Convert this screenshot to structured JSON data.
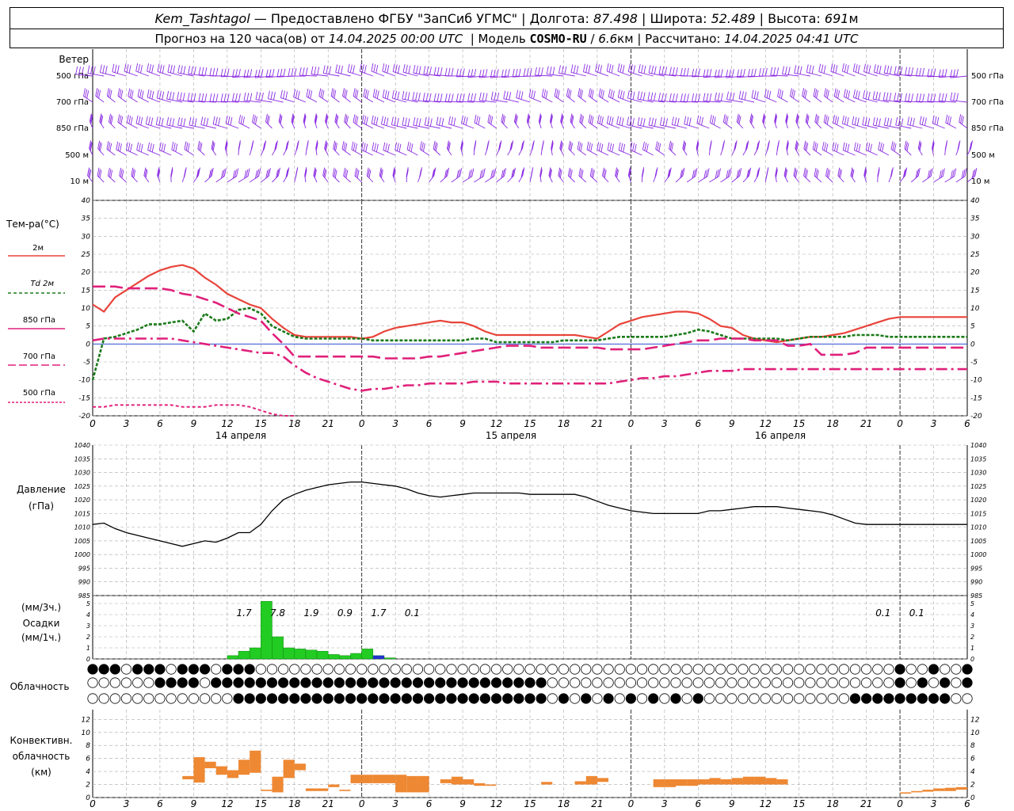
{
  "header": {
    "station": "Kem_Tashtagol",
    "provider": " — Предоставлено ФГБУ \"ЗапСиб УГМС\" | Долгота: ",
    "lon": "87.498",
    "lat_label": " | Широта: ",
    "lat": "52.489",
    "alt_label": " | Высота: ",
    "alt": "691",
    "alt_unit": "м",
    "forecast_prefix": "Прогноз на 120 часа(ов) от ",
    "forecast_start": "14.04.2025 00:00 UTC",
    "model_label": "  | Модель ",
    "model": "COSMO-RU",
    "res_sep": " / ",
    "resolution": "6.6",
    "res_unit": "км",
    "computed_label": " | Рассчитано: ",
    "computed": "14.04.2025 04:41 UTC"
  },
  "wind": {
    "title": "Ветер",
    "levels": [
      "500 гПа",
      "700 гПа",
      "850 гПа",
      "500 м",
      "10  м"
    ],
    "barb_color": "#8a2be2"
  },
  "temperature": {
    "title": "Тем-ра(°С)",
    "yticks": [
      40,
      35,
      30,
      25,
      20,
      15,
      10,
      5,
      0,
      -5,
      -10,
      -15,
      -20
    ],
    "legend": [
      "2м",
      "Td  2м",
      "850 гПа",
      "700 гПа",
      "500 гПа"
    ],
    "colors": {
      "t2m": "#e8443a",
      "td2m": "#1a7a1a",
      "t850": "#e0207a",
      "t700": "#e0207a",
      "t500": "#e0207a",
      "zero": "#3050d0"
    }
  },
  "time_axis": {
    "xticks": [
      "0",
      "3",
      "6",
      "9",
      "12",
      "15",
      "18",
      "21",
      "0",
      "3",
      "6",
      "9",
      "12",
      "15",
      "18",
      "21",
      "0",
      "3",
      "6",
      "9",
      "12",
      "15",
      "18",
      "21",
      "0",
      "3",
      "6"
    ],
    "days": [
      "14 апреля",
      "15 апреля",
      "16 апреля"
    ]
  },
  "pressure": {
    "title": "Давление",
    "unit": "(гПа)",
    "yticks": [
      1040,
      1035,
      1030,
      1025,
      1020,
      1015,
      1010,
      1005,
      1000,
      995,
      990,
      985
    ]
  },
  "precip": {
    "unit3": "(мм/3ч.)",
    "title": "Осадки",
    "unit1": "(мм/1ч.)",
    "yticks": [
      5,
      4,
      3,
      2,
      1,
      0
    ],
    "labels": [
      "1.7",
      "7.8",
      "1.9",
      "0.9",
      "1.7",
      "0.1",
      "0.1",
      "0.1"
    ],
    "colors": {
      "rain": "#22cc22",
      "snow": "#2233cc"
    }
  },
  "cloudiness": {
    "title": "Облачность"
  },
  "convective": {
    "title_lines": [
      "Конвективн.",
      "облачность",
      "(км)"
    ],
    "yticks": [
      12,
      10,
      8,
      6,
      4,
      2,
      0
    ],
    "color": "#ee8833"
  },
  "chart_data": [
    {
      "type": "line",
      "title": "Тем-ра(°С)",
      "x_hours": [
        0,
        1,
        2,
        3,
        4,
        5,
        6,
        7,
        8,
        9,
        10,
        11,
        12,
        13,
        14,
        15,
        16,
        17,
        18,
        19,
        20,
        21,
        22,
        23,
        24,
        25,
        26,
        27,
        28,
        29,
        30,
        31,
        32,
        33,
        34,
        35,
        36,
        37,
        38,
        39,
        40,
        41,
        42,
        43,
        44,
        45,
        46,
        47,
        48,
        49,
        50,
        51,
        52,
        53,
        54,
        55,
        56,
        57,
        58,
        59,
        60,
        61,
        62,
        63,
        64,
        65,
        66,
        67,
        68,
        69,
        70,
        71,
        72,
        73,
        74,
        75,
        76,
        77,
        78
      ],
      "ylim": [
        -20,
        40
      ],
      "series": [
        {
          "name": "2м",
          "values": [
            11,
            9,
            13,
            15,
            17,
            19,
            20.5,
            21.5,
            22,
            21,
            18.5,
            16.5,
            14,
            12.5,
            11,
            10,
            7,
            4.5,
            2.5,
            2,
            2,
            2,
            2,
            2,
            1.5,
            2,
            3.5,
            4.5,
            5,
            5.5,
            6,
            6.5,
            6,
            6,
            5,
            3.5,
            2.5,
            2.5,
            2.5,
            2.5,
            2.5,
            2.5,
            2.5,
            2.5,
            2,
            1.5,
            3.5,
            5.5,
            6.5,
            7.5,
            8,
            8.5,
            9,
            9,
            8.5,
            7,
            5,
            4.5,
            2.5,
            1.5,
            1,
            0.5,
            1,
            1.5,
            2,
            2,
            2.5,
            3,
            4,
            5,
            6,
            7,
            7.5,
            7.5,
            7.5,
            7.5,
            7.5,
            7.5,
            7.5
          ]
        },
        {
          "name": "Td 2м",
          "values": [
            -10,
            1.5,
            2,
            3,
            4,
            5.5,
            5.5,
            6,
            6.5,
            3.5,
            8.5,
            6.5,
            7,
            9.5,
            10,
            8.5,
            5,
            3.5,
            2,
            1.5,
            1.5,
            1.5,
            1.5,
            1.5,
            1.5,
            1,
            1,
            1,
            1,
            1,
            1,
            1,
            1,
            1,
            1.5,
            1.5,
            0.5,
            0.5,
            0.5,
            0.5,
            0.5,
            0.5,
            1,
            1,
            1,
            1,
            1.5,
            2,
            2,
            2,
            2,
            2,
            2.5,
            3,
            4,
            3.5,
            2.5,
            1.5,
            1.5,
            1.5,
            1.5,
            1.5,
            1,
            1.5,
            2,
            2,
            2,
            2,
            2.5,
            2.5,
            2.5,
            2,
            2,
            2,
            2,
            2,
            2,
            2,
            2
          ]
        },
        {
          "name": "850 гПа",
          "values": [
            16,
            16,
            16,
            15.5,
            15.5,
            15.5,
            15.5,
            15,
            14,
            13.5,
            12.5,
            11.5,
            10,
            8.5,
            7.5,
            6.5,
            3,
            0,
            -3.5,
            -3.5,
            -3.5,
            -3.5,
            -3.5,
            -3.5,
            -3.5,
            -3.5,
            -4,
            -4,
            -4,
            -4,
            -3.5,
            -3.5,
            -3,
            -2.5,
            -2,
            -1.5,
            -1,
            -0.5,
            -0.5,
            -0.5,
            -1,
            -1,
            -1,
            -1,
            -1,
            -1,
            -1.5,
            -1.5,
            -1.5,
            -1.5,
            -1,
            -0.5,
            0,
            0.5,
            1,
            1,
            1.5,
            1.5,
            1.5,
            1,
            1,
            1,
            -0.5,
            -0.5,
            0,
            -3,
            -3,
            -3,
            -2.5,
            -1,
            -1,
            -1,
            -1,
            -1,
            -1,
            -1,
            -1,
            -1,
            -1
          ]
        },
        {
          "name": "700 гПа",
          "values": [
            1,
            1.5,
            1.5,
            1.5,
            1.5,
            1.5,
            1.5,
            1.5,
            1,
            0.5,
            0,
            -0.5,
            -1,
            -1.5,
            -2,
            -2.5,
            -2.5,
            -3.5,
            -6,
            -8,
            -9.5,
            -10.5,
            -11.5,
            -12.5,
            -13,
            -12.5,
            -12.5,
            -12,
            -11.5,
            -11.5,
            -11,
            -11,
            -11,
            -11,
            -10.5,
            -10.5,
            -10.5,
            -11,
            -11,
            -11,
            -11,
            -11,
            -11,
            -11,
            -11,
            -11,
            -11,
            -10.5,
            -10,
            -9.5,
            -9.5,
            -9,
            -9,
            -8.5,
            -8,
            -7.5,
            -7.5,
            -7.5,
            -7,
            -7,
            -7,
            -7,
            -7,
            -7,
            -7,
            -7,
            -7,
            -7,
            -7,
            -7,
            -7,
            -7,
            -7,
            -7,
            -7,
            -7,
            -7,
            -7,
            -7
          ]
        },
        {
          "name": "500 гПа",
          "values": [
            -17.5,
            -17.5,
            -17,
            -17,
            -17,
            -17,
            -17,
            -17,
            -17.5,
            -17.5,
            -17.5,
            -17,
            -17,
            -17,
            -17.5,
            -18.5,
            -19.5,
            -20,
            -20
          ]
        }
      ]
    },
    {
      "type": "line",
      "title": "Давление",
      "x_hours": [
        0,
        1,
        2,
        3,
        4,
        5,
        6,
        7,
        8,
        9,
        10,
        11,
        12,
        13,
        14,
        15,
        16,
        17,
        18,
        19,
        20,
        21,
        22,
        23,
        24,
        25,
        26,
        27,
        28,
        29,
        30,
        31,
        32,
        33,
        34,
        35,
        36,
        37,
        38,
        39,
        40,
        41,
        42,
        43,
        44,
        45,
        46,
        47,
        48,
        49,
        50,
        51,
        52,
        53,
        54,
        55,
        56,
        57,
        58,
        59,
        60,
        61,
        62,
        63,
        64,
        65,
        66,
        67,
        68,
        69,
        70,
        71,
        72,
        73,
        74,
        75,
        76,
        77,
        78
      ],
      "ylim": [
        985,
        1040
      ],
      "series": [
        {
          "name": "Давление",
          "values": [
            1011,
            1011.5,
            1009.5,
            1008,
            1007,
            1006,
            1005,
            1004,
            1003,
            1004,
            1005,
            1004.5,
            1006,
            1008,
            1008,
            1011,
            1016,
            1020,
            1022,
            1023.5,
            1024.5,
            1025.5,
            1026,
            1026.5,
            1026.5,
            1026,
            1025.5,
            1025,
            1024,
            1022.5,
            1021.5,
            1021,
            1021.5,
            1022,
            1022.5,
            1022.5,
            1022.5,
            1022.5,
            1022.5,
            1022,
            1022,
            1022,
            1022,
            1022,
            1021,
            1019.5,
            1018,
            1017,
            1016,
            1015.5,
            1015,
            1015,
            1015,
            1015,
            1015,
            1016,
            1016,
            1016.5,
            1017,
            1017.5,
            1017.5,
            1017.5,
            1017,
            1016.5,
            1016,
            1015.5,
            1014.5,
            1013,
            1011.5,
            1011,
            1011,
            1011,
            1011,
            1011,
            1011,
            1011,
            1011,
            1011,
            1011
          ]
        }
      ]
    },
    {
      "type": "bar",
      "title": "Осадки",
      "x_hours": [
        12,
        13,
        14,
        15,
        16,
        17,
        18,
        19,
        20,
        21,
        22,
        23,
        24,
        25,
        26,
        27,
        28,
        29,
        30,
        31,
        32,
        33,
        34,
        35,
        36,
        37,
        38,
        39,
        40,
        41,
        42,
        43,
        44,
        45,
        46,
        47,
        48,
        49,
        50,
        51,
        52,
        53,
        54,
        55,
        56,
        57,
        58,
        59,
        60,
        61,
        62,
        63,
        64,
        65,
        66,
        67,
        68,
        69,
        70,
        71
      ],
      "ylim": [
        0,
        5
      ],
      "series": [
        {
          "name": "rain",
          "values": [
            0.3,
            0.7,
            1,
            5.2,
            2,
            1,
            0.9,
            0.8,
            0.7,
            0.4,
            0.3,
            0.5,
            0.9,
            0.3,
            0.1,
            0,
            0,
            0,
            0,
            0,
            0,
            0,
            0,
            0,
            0,
            0,
            0,
            0,
            0,
            0,
            0,
            0,
            0,
            0,
            0,
            0,
            0,
            0,
            0,
            0,
            0,
            0,
            0,
            0,
            0,
            0,
            0,
            0,
            0,
            0,
            0,
            0,
            0,
            0,
            0,
            0,
            0,
            0,
            0,
            0
          ]
        },
        {
          "name": "snow",
          "values": [
            0,
            0,
            0,
            0,
            0,
            0,
            0,
            0,
            0,
            0,
            0,
            0,
            0,
            0.3,
            0,
            0,
            0,
            0,
            0,
            0,
            0,
            0,
            0,
            0,
            0,
            0,
            0,
            0,
            0,
            0,
            0,
            0,
            0,
            0,
            0,
            0,
            0,
            0,
            0,
            0,
            0,
            0,
            0,
            0,
            0,
            0,
            0,
            0,
            0,
            0,
            0,
            0,
            0,
            0,
            0,
            0,
            0,
            0,
            0,
            0
          ]
        }
      ]
    },
    {
      "type": "bar",
      "title": "Конвективн. облачность (км)",
      "ylim": [
        0,
        13
      ],
      "bars": [
        {
          "x": 8.5,
          "base": 2.8,
          "top": 3.3
        },
        {
          "x": 9.5,
          "base": 2.3,
          "top": 6.2
        },
        {
          "x": 10.5,
          "base": 4.5,
          "top": 5.5
        },
        {
          "x": 11.5,
          "base": 3.5,
          "top": 4.8
        },
        {
          "x": 12.5,
          "base": 3,
          "top": 4.2
        },
        {
          "x": 13.5,
          "base": 3.5,
          "top": 5.8
        },
        {
          "x": 14.5,
          "base": 3.8,
          "top": 7.2
        },
        {
          "x": 15.5,
          "base": 1,
          "top": 1.2
        },
        {
          "x": 16.5,
          "base": 0.8,
          "top": 3.2
        },
        {
          "x": 17.5,
          "base": 3,
          "top": 5.8
        },
        {
          "x": 18.5,
          "base": 4.2,
          "top": 5.2
        },
        {
          "x": 19.5,
          "base": 1,
          "top": 1.4
        },
        {
          "x": 20.5,
          "base": 1,
          "top": 1.4
        },
        {
          "x": 21.5,
          "base": 1.6,
          "top": 2
        },
        {
          "x": 22.5,
          "base": 1,
          "top": 1.2
        },
        {
          "x": 23.5,
          "base": 2.2,
          "top": 3.5
        },
        {
          "x": 24.5,
          "base": 2.2,
          "top": 3.5
        },
        {
          "x": 25.5,
          "base": 2.2,
          "top": 3.5
        },
        {
          "x": 26.5,
          "base": 2.2,
          "top": 3.5
        },
        {
          "x": 27.5,
          "base": 0.8,
          "top": 3.5
        },
        {
          "x": 28.5,
          "base": 0.8,
          "top": 3.3
        },
        {
          "x": 29.5,
          "base": 0.8,
          "top": 3.3
        },
        {
          "x": 31.5,
          "base": 2.2,
          "top": 2.8
        },
        {
          "x": 32.5,
          "base": 2,
          "top": 3.2
        },
        {
          "x": 33.5,
          "base": 2,
          "top": 2.8
        },
        {
          "x": 34.5,
          "base": 1.8,
          "top": 2.2
        },
        {
          "x": 35.5,
          "base": 1.8,
          "top": 2
        },
        {
          "x": 40.5,
          "base": 2,
          "top": 2.4
        },
        {
          "x": 43.5,
          "base": 2,
          "top": 2.5
        },
        {
          "x": 44.5,
          "base": 2,
          "top": 3.3
        },
        {
          "x": 45.5,
          "base": 2.4,
          "top": 3
        },
        {
          "x": 50.5,
          "base": 1.6,
          "top": 2.8
        },
        {
          "x": 51.5,
          "base": 1.6,
          "top": 2.8
        },
        {
          "x": 52.5,
          "base": 1.8,
          "top": 2.8
        },
        {
          "x": 53.5,
          "base": 1.8,
          "top": 2.8
        },
        {
          "x": 54.5,
          "base": 2,
          "top": 2.8
        },
        {
          "x": 55.5,
          "base": 2,
          "top": 3
        },
        {
          "x": 56.5,
          "base": 2,
          "top": 2.8
        },
        {
          "x": 57.5,
          "base": 2,
          "top": 3
        },
        {
          "x": 58.5,
          "base": 2,
          "top": 3.2
        },
        {
          "x": 59.5,
          "base": 2,
          "top": 3.2
        },
        {
          "x": 60.5,
          "base": 2,
          "top": 3
        },
        {
          "x": 61.5,
          "base": 2,
          "top": 2.8
        },
        {
          "x": 72.5,
          "base": 0.6,
          "top": 0.8
        },
        {
          "x": 73.5,
          "base": 0.8,
          "top": 1
        },
        {
          "x": 74.5,
          "base": 0.9,
          "top": 1.2
        },
        {
          "x": 75.5,
          "base": 1,
          "top": 1.4
        },
        {
          "x": 76.5,
          "base": 1,
          "top": 1.5
        },
        {
          "x": 77.5,
          "base": 1.2,
          "top": 1.6
        }
      ]
    }
  ]
}
